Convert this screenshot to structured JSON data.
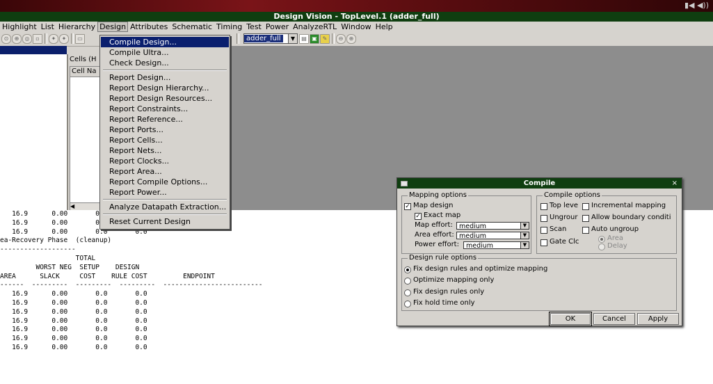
{
  "window": {
    "title": "Design Vision - TopLevel.1 (adder_full)"
  },
  "menubar": [
    "Highlight",
    "List",
    "Hierarchy",
    "Design",
    "Attributes",
    "Schematic",
    "Timing",
    "Test",
    "Power",
    "AnalyzeRTL",
    "Window",
    "Help"
  ],
  "toolbar": {
    "design_select": "adder_full"
  },
  "left_panel": {
    "cells_label": "Cells (H",
    "cell_name_header": "Cell Na"
  },
  "design_menu": {
    "items": [
      "Compile Design...",
      "Compile Ultra...",
      "Check Design...",
      "Report Design...",
      "Report Design Hierarchy...",
      "Report Design Resources...",
      "Report Constraints...",
      "Report Reference...",
      "Report Ports...",
      "Report Cells...",
      "Report Nets...",
      "Report Clocks...",
      "Report Area...",
      "Report Compile Options...",
      "Report Power...",
      "Analyze Datapath Extraction...",
      "Reset Current Design"
    ]
  },
  "console": {
    "lines": [
      "   16.9      0.00       0.0       0.0",
      "   16.9      0.00       0.0       0.0",
      "   16.9      0.00       0.0       0.0",
      "",
      "ea-Recovery Phase  (cleanup)",
      "-------------------",
      "",
      "                   TOTAL",
      "         WORST NEG  SETUP    DESIGN",
      "AREA      SLACK     COST    RULE COST         ENDPOINT",
      "------  ---------  ---------  ---------  -------------------------",
      "   16.9      0.00       0.0       0.0",
      "   16.9      0.00       0.0       0.0",
      "   16.9      0.00       0.0       0.0",
      "   16.9      0.00       0.0       0.0",
      "   16.9      0.00       0.0       0.0",
      "   16.9      0.00       0.0       0.0",
      "   16.9      0.00       0.0       0.0"
    ]
  },
  "compile_dialog": {
    "title": "Compile",
    "mapping_group": "Mapping options",
    "map_design": "Map design",
    "exact_map": "Exact map",
    "map_effort_label": "Map effort:",
    "map_effort_value": "medium",
    "area_effort_label": "Area effort:",
    "area_effort_value": "medium",
    "power_effort_label": "Power effort:",
    "power_effort_value": "medium",
    "compile_group": "Compile options",
    "top_level": "Top leve",
    "incremental_mapping": "Incremental mapping",
    "ungroup": "Ungrour",
    "allow_boundary": "Allow boundary conditi",
    "scan": "Scan",
    "auto_ungroup": "Auto ungroup",
    "gate_clock": "Gate Clc",
    "area": "Area",
    "delay": "Delay",
    "design_rule_group": "Design rule options",
    "dr_opt1": "Fix design rules and  optimize mapping",
    "dr_opt2": "Optimize mapping only",
    "dr_opt3": "Fix design rules only",
    "dr_opt4": "Fix hold time only",
    "ok": "OK",
    "cancel": "Cancel",
    "apply": "Apply"
  }
}
